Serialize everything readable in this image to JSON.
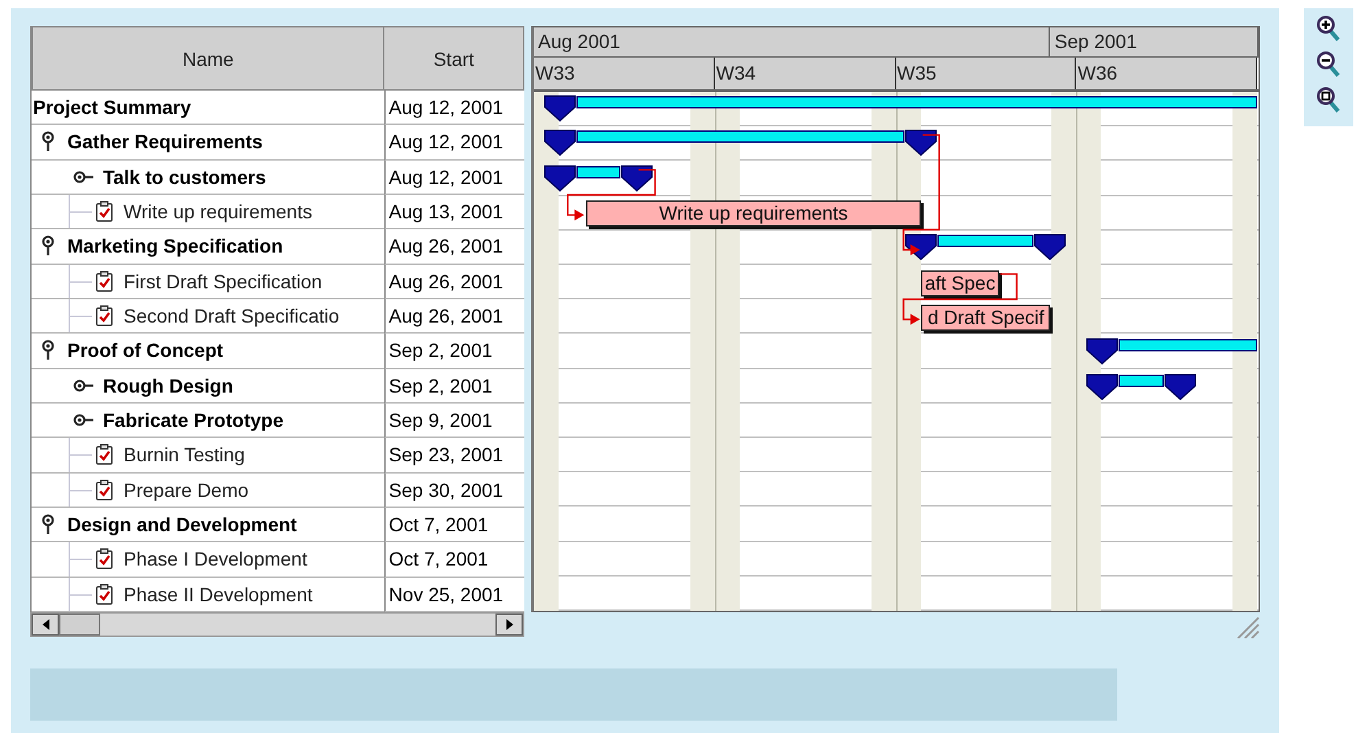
{
  "table": {
    "columns": [
      "Name",
      "Start"
    ],
    "rows": [
      {
        "name": "Project Summary",
        "start": "Aug 12, 2001",
        "kind": "project",
        "bar": {
          "kind": "summary"
        },
        "children": [
          {
            "name": "Gather Requirements",
            "start": "Aug 12, 2001",
            "kind": "summary",
            "expanded": true,
            "bar": {
              "kind": "summary"
            },
            "children": [
              {
                "name": "Talk to customers",
                "start": "Aug 12, 2001",
                "kind": "summary",
                "expanded": false,
                "bar": {
                  "kind": "summary"
                }
              },
              {
                "name": "Write up requirements",
                "start": "Aug 13, 2001",
                "kind": "task",
                "bar": {
                  "kind": "task",
                  "label": "Write up requirements",
                  "depends_on_previous": true
                }
              }
            ]
          },
          {
            "name": "Marketing Specification",
            "start": "Aug 26, 2001",
            "kind": "summary",
            "expanded": true,
            "bar": {
              "kind": "summary",
              "depends_on_previous": true
            },
            "children": [
              {
                "name": "First Draft Specification",
                "start": "Aug 26, 2001",
                "kind": "task",
                "bar": {
                  "kind": "task",
                  "label": "aft Spec"
                }
              },
              {
                "name": "Second Draft Specificatio",
                "start": "Aug 26, 2001",
                "kind": "task",
                "bar": {
                  "kind": "task",
                  "label": "d Draft Specif",
                  "depends_on_previous": true
                }
              }
            ]
          },
          {
            "name": "Proof of Concept",
            "start": "Sep 2, 2001",
            "kind": "summary",
            "expanded": true,
            "bar": {
              "kind": "summary"
            },
            "children": [
              {
                "name": "Rough Design",
                "start": "Sep 2, 2001",
                "kind": "summary",
                "expanded": false,
                "bar": {
                  "kind": "summary"
                }
              },
              {
                "name": "Fabricate Prototype",
                "start": "Sep 9, 2001",
                "kind": "summary",
                "expanded": false
              },
              {
                "name": "Burnin Testing",
                "start": "Sep 23, 2001",
                "kind": "task"
              },
              {
                "name": "Prepare Demo",
                "start": "Sep 30, 2001",
                "kind": "task"
              }
            ]
          },
          {
            "name": "Design and Development",
            "start": "Oct 7, 2001",
            "kind": "summary",
            "expanded": true,
            "children": [
              {
                "name": "Phase I Development",
                "start": "Oct 7, 2001",
                "kind": "task"
              },
              {
                "name": "Phase II Development",
                "start": "Nov 25, 2001",
                "kind": "task"
              }
            ]
          }
        ]
      }
    ]
  },
  "gantt": {
    "months": [
      "Aug 2001",
      "Sep 2001"
    ],
    "weeks": [
      "W33",
      "W34",
      "W35",
      "W36"
    ]
  },
  "zoom_tools": [
    {
      "kind": "zoom-in"
    },
    {
      "kind": "zoom-out"
    },
    {
      "kind": "zoom-fit"
    }
  ]
}
